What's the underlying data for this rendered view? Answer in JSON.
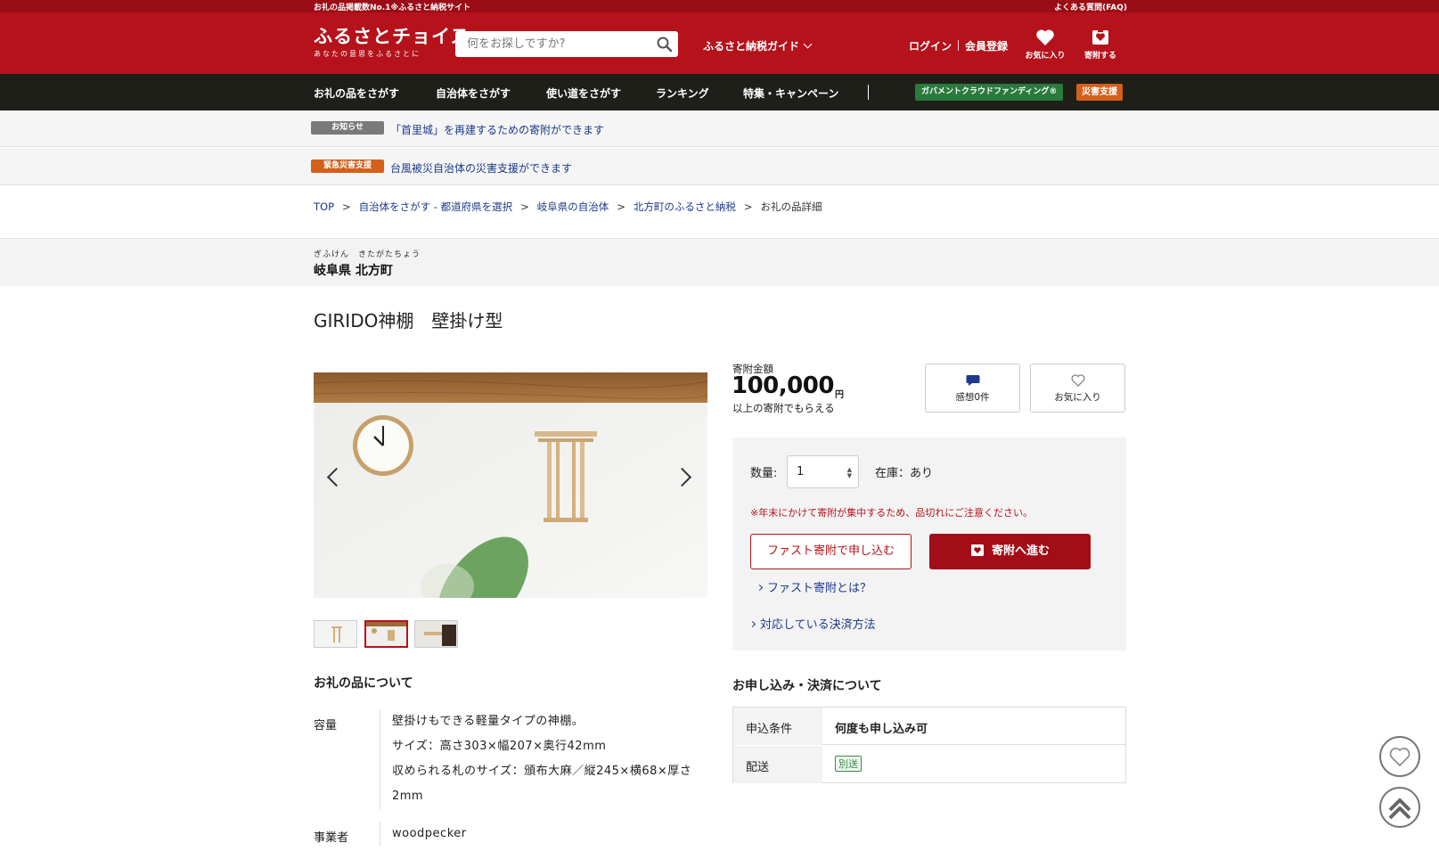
{
  "topbar": {
    "left": "お礼の品掲載数No.1※ふるさと納税サイト",
    "right": "よくある質問(FAQ)"
  },
  "header": {
    "logo_main": "ふるさとチョイス",
    "logo_sub": "あなたの意思をふるさとに",
    "search_placeholder": "何をお探しですか?",
    "guide": "ふるさと納税ガイド",
    "login": "ログイン",
    "register": "会員登録",
    "favorite": "お気に入り",
    "donate": "寄附する"
  },
  "nav": {
    "items": [
      "お礼の品をさがす",
      "自治体をさがす",
      "使い道をさがす",
      "ランキング",
      "特集・キャンペーン"
    ],
    "gcf": "ガバメントクラウドファンディング®",
    "disaster": "災害支援"
  },
  "notices": [
    {
      "tag": "お知らせ",
      "text": "「首里城」を再建するための寄附ができます",
      "tag_color": "#7a7a7a"
    },
    {
      "tag": "緊急災害支援",
      "text": "台風被災自治体の災害支援ができます",
      "tag_color": "#d4601a"
    }
  ],
  "breadcrumb": {
    "items": [
      "TOP",
      "自治体をさがす - 都道府県を選択",
      "岐阜県の自治体",
      "北方町のふるさと納税"
    ],
    "current": "お礼の品詳細",
    "sep": ">"
  },
  "municipality": {
    "ruby": "ぎふけん　きたがたちょう",
    "name": "岐阜県 北方町"
  },
  "product": {
    "title": "GIRIDO神棚　壁掛け型",
    "price_label": "寄附金額",
    "price": "100,000",
    "unit": "円",
    "price_note": "以上の寄附でもらえる",
    "reviews": "感想0件",
    "favorite": "お気に入り",
    "qty_label": "数量:",
    "qty_value": "1",
    "stock": "在庫：あり",
    "warning": "※年末にかけて寄附が集中するため、品切れにご注意ください。",
    "fast_button": "ファスト寄附で申し込む",
    "donate_button": "寄附へ進む",
    "fast_link": "ファスト寄附とは？",
    "payment_link": "対応している決済方法"
  },
  "about": {
    "heading": "お礼の品について",
    "rows": [
      {
        "label": "容量",
        "lines": [
          "壁掛けもできる軽量タイプの神棚。",
          "サイズ：高さ303×幅207×奥行42mm",
          "収められる札のサイズ：頒布大麻／縦245×横68×厚さ2mm"
        ]
      },
      {
        "label": "事業者",
        "lines": [
          "woodpecker"
        ]
      }
    ]
  },
  "conditions": {
    "heading": "お申し込み・決済について",
    "rows": [
      {
        "key": "申込条件",
        "value": "何度も申し込み可"
      },
      {
        "key": "配送",
        "value": "別送"
      }
    ]
  },
  "colors": {
    "brand": "#b5121b",
    "nav": "#1f1f1a",
    "link": "#1c3a8c"
  }
}
